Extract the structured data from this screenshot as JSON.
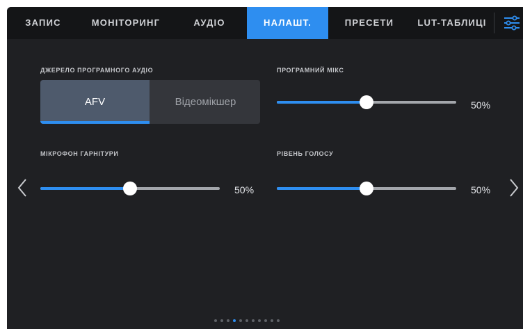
{
  "tabs": [
    {
      "label": "ЗАПИС",
      "active": false
    },
    {
      "label": "МОНІТОРИНГ",
      "active": false
    },
    {
      "label": "АУДІО",
      "active": false
    },
    {
      "label": "НАЛАШТ.",
      "active": true
    },
    {
      "label": "ПРЕСЕТИ",
      "active": false
    },
    {
      "label": "LUT-ТАБЛИЦІ",
      "active": false
    }
  ],
  "settings_icon": "sliders-icon",
  "program_audio_source": {
    "label": "ДЖЕРЕЛО ПРОГРАМНОГО АУДІО",
    "options": [
      "AFV",
      "Відеомікшер"
    ],
    "selected": "AFV"
  },
  "program_mix": {
    "label": "ПРОГРАМНИЙ МІКС",
    "value": 50,
    "value_text": "50%"
  },
  "headset_mic": {
    "label": "МІКРОФОН ГАРНІТУРИ",
    "value": 50,
    "value_text": "50%"
  },
  "voice_level": {
    "label": "РІВЕНЬ ГОЛОСУ",
    "value": 50,
    "value_text": "50%"
  },
  "pagination": {
    "total": 11,
    "current": 4
  },
  "colors": {
    "accent": "#2e8ef0",
    "background": "#1f2023",
    "tabbar": "#141517",
    "selected_segment": "#4e5a6c"
  }
}
